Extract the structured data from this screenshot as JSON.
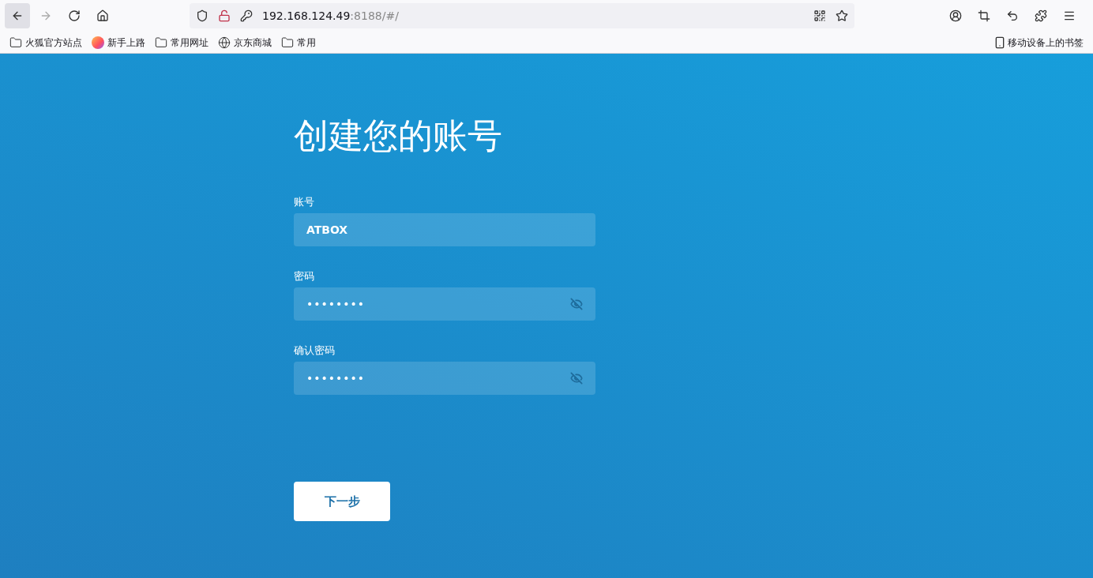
{
  "browser": {
    "url_host": "192.168.124.49",
    "url_rest": ":8188/#/"
  },
  "bookmarks": [
    {
      "kind": "folder",
      "label": "火狐官方站点"
    },
    {
      "kind": "firefox",
      "label": "新手上路"
    },
    {
      "kind": "folder",
      "label": "常用网址"
    },
    {
      "kind": "globe",
      "label": "京东商城"
    },
    {
      "kind": "folder",
      "label": "常用"
    }
  ],
  "mobile_bookmarks": "移动设备上的书签",
  "page": {
    "title": "创建您的账号",
    "fields": [
      {
        "kind": "text",
        "label": "账号",
        "value": "ATBOX"
      },
      {
        "kind": "password",
        "label": "密码",
        "value": "••••••••"
      },
      {
        "kind": "password",
        "label": "确认密码",
        "value": "••••••••"
      }
    ],
    "next_button": "下一步"
  }
}
